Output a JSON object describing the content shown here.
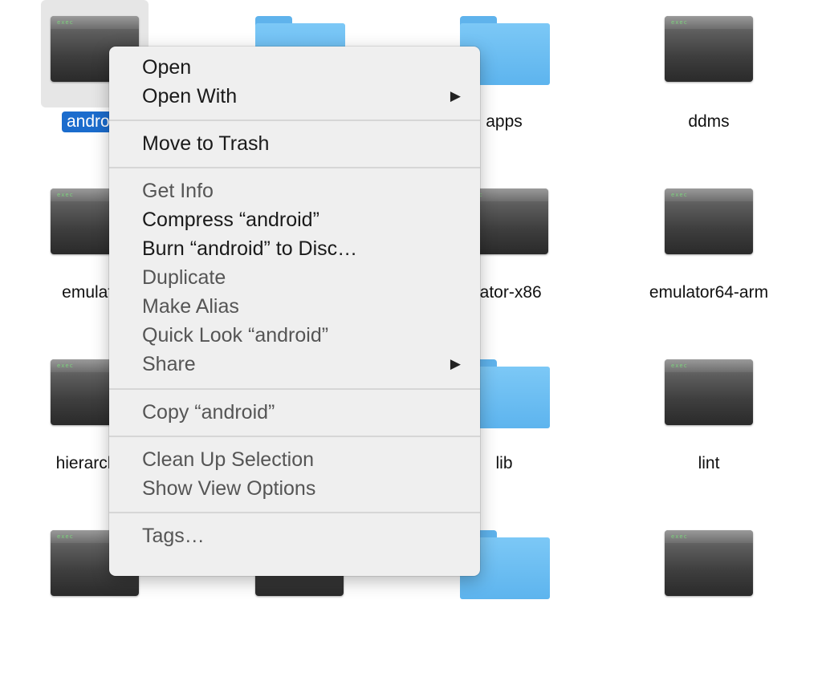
{
  "items": [
    {
      "label": "android",
      "kind": "exec",
      "selected": true
    },
    {
      "label": "",
      "kind": "folder"
    },
    {
      "label": "apps",
      "kind": "folder"
    },
    {
      "label": "ddms",
      "kind": "exec"
    },
    {
      "label": "emulator",
      "kind": "exec"
    },
    {
      "label": "",
      "kind": "exec"
    },
    {
      "label": "ulator-x86",
      "kind": "exec"
    },
    {
      "label": "emulator64-arm",
      "kind": "exec"
    },
    {
      "label": "hierarchyv",
      "kind": "exec"
    },
    {
      "label": "",
      "kind": "exec"
    },
    {
      "label": "lib",
      "kind": "folder"
    },
    {
      "label": "lint",
      "kind": "exec"
    },
    {
      "label": "",
      "kind": "exec"
    },
    {
      "label": "",
      "kind": "exec"
    },
    {
      "label": "",
      "kind": "folder"
    },
    {
      "label": "",
      "kind": "exec"
    }
  ],
  "exec_badge": "exec",
  "context_menu": {
    "open": "Open",
    "open_with": "Open With",
    "move_to_trash": "Move to Trash",
    "get_info": "Get Info",
    "compress": "Compress “android”",
    "burn": "Burn “android” to Disc…",
    "duplicate": "Duplicate",
    "make_alias": "Make Alias",
    "quick_look": "Quick Look “android”",
    "share": "Share",
    "copy": "Copy “android”",
    "clean_up": "Clean Up Selection",
    "show_view_options": "Show View Options",
    "tags": "Tags…",
    "submenu_arrow": "▶"
  },
  "colors": {
    "selection": "#1b6ccd",
    "folder": "#6cbef3",
    "menu_bg": "#efefef"
  }
}
